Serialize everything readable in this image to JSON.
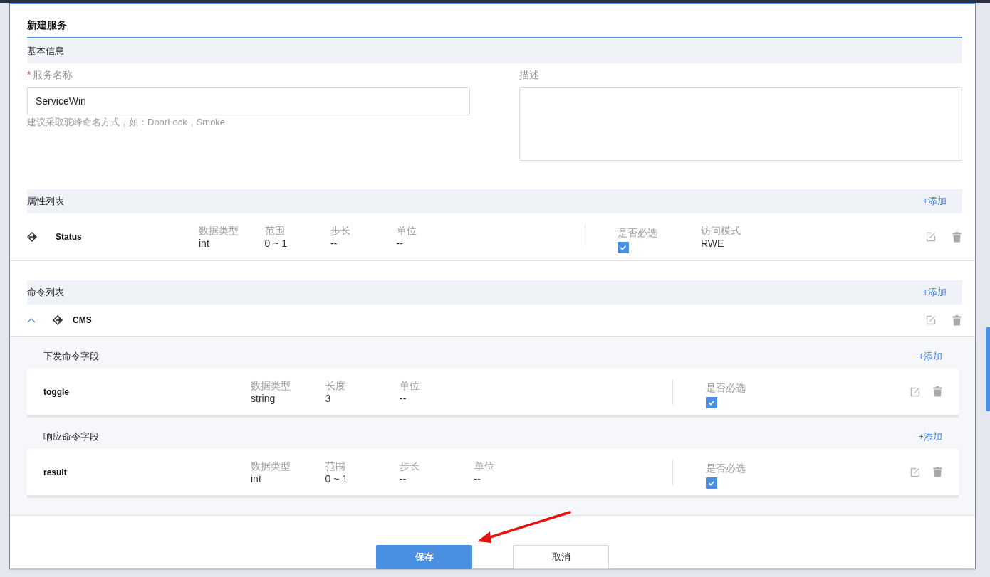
{
  "dialog": {
    "title": "新建服务"
  },
  "basic_info": {
    "heading": "基本信息",
    "name_field": {
      "required_mark": "*",
      "label": "服务名称",
      "value": "ServiceWin",
      "hint": "建议采取驼峰命名方式，如：DoorLock，Smoke"
    },
    "description_field": {
      "label": "描述"
    }
  },
  "properties": {
    "heading": "属性列表",
    "add": "+添加",
    "rows": [
      {
        "name": "Status",
        "fields": [
          {
            "label": "数据类型",
            "value": "int"
          },
          {
            "label": "范围",
            "value": "0 ~ 1"
          },
          {
            "label": "步长",
            "value": "--"
          },
          {
            "label": "单位",
            "value": "--"
          }
        ],
        "required": {
          "label": "是否必选",
          "checked": true
        },
        "access": {
          "label": "访问模式",
          "value": "RWE"
        }
      }
    ]
  },
  "commands": {
    "heading": "命令列表",
    "add": "+添加",
    "items": [
      {
        "name": "CMS",
        "expanded": true,
        "sections": [
          {
            "heading": "下发命令字段",
            "add": "+添加",
            "rows": [
              {
                "name": "toggle",
                "fields": [
                  {
                    "label": "数据类型",
                    "value": "string"
                  },
                  {
                    "label": "长度",
                    "value": "3"
                  },
                  {
                    "label": "单位",
                    "value": "--"
                  }
                ],
                "required": {
                  "label": "是否必选",
                  "checked": true
                }
              }
            ]
          },
          {
            "heading": "响应命令字段",
            "add": "+添加",
            "rows": [
              {
                "name": "result",
                "fields": [
                  {
                    "label": "数据类型",
                    "value": "int"
                  },
                  {
                    "label": "范围",
                    "value": "0 ~ 1"
                  },
                  {
                    "label": "步长",
                    "value": "--"
                  },
                  {
                    "label": "单位",
                    "value": "--"
                  }
                ],
                "required": {
                  "label": "是否必选",
                  "checked": true
                }
              }
            ]
          }
        ]
      }
    ]
  },
  "buttons": [
    {
      "label": "保存",
      "kind": "primary"
    },
    {
      "label": "取消",
      "kind": "secondary"
    }
  ]
}
